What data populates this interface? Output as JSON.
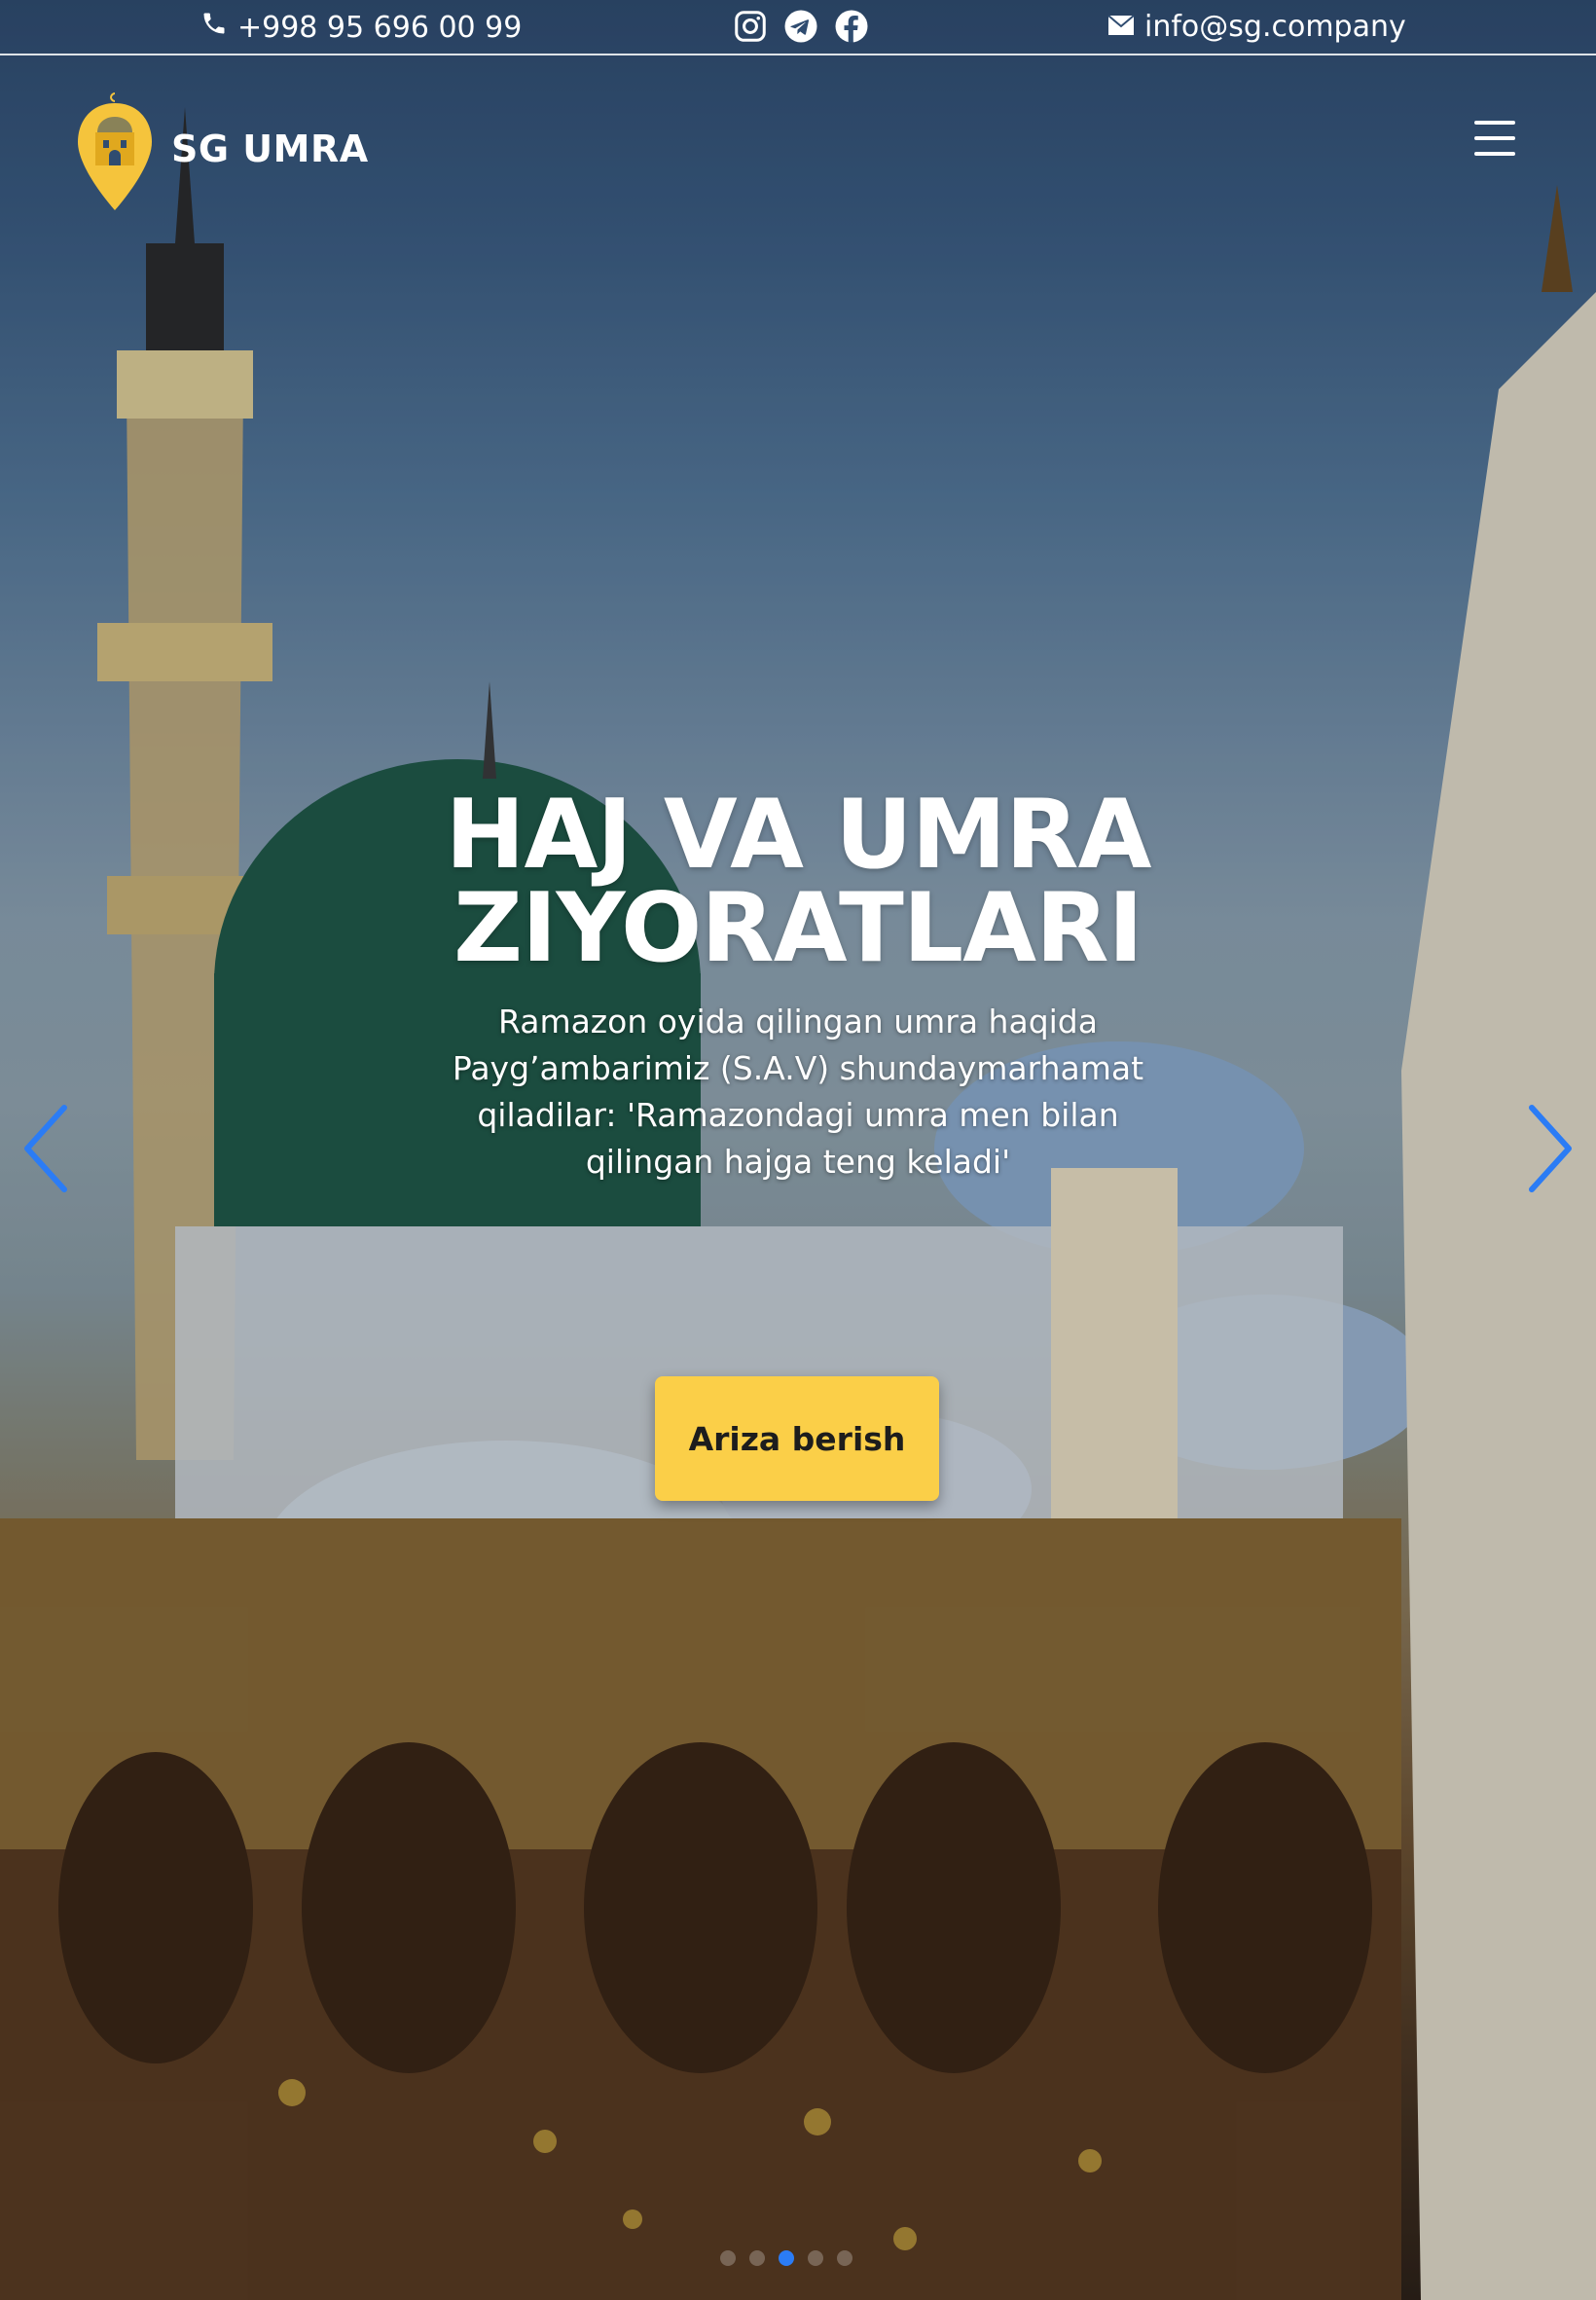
{
  "topbar": {
    "phone": "+998 95 696 00 99",
    "email": "info@sg.company",
    "socials": [
      "instagram-icon",
      "telegram-icon",
      "facebook-icon"
    ]
  },
  "brand": {
    "name": "SG UMRA"
  },
  "hero": {
    "title": "HAJ VA UMRA ZIYORATLARI",
    "text": "Ramazon oyida qilingan umra haqida Payg’ambarimiz (S.A.V) shundaymarhamat qiladilar: 'Ramazondagi umra men bilan qilingan hajga teng keladi'",
    "cta_label": "Ariza berish",
    "slides_total": 5,
    "active_slide": 3
  },
  "colors": {
    "accent": "#fbcf48",
    "nav_arrow": "#2b7cf5",
    "text": "#ffffff"
  }
}
